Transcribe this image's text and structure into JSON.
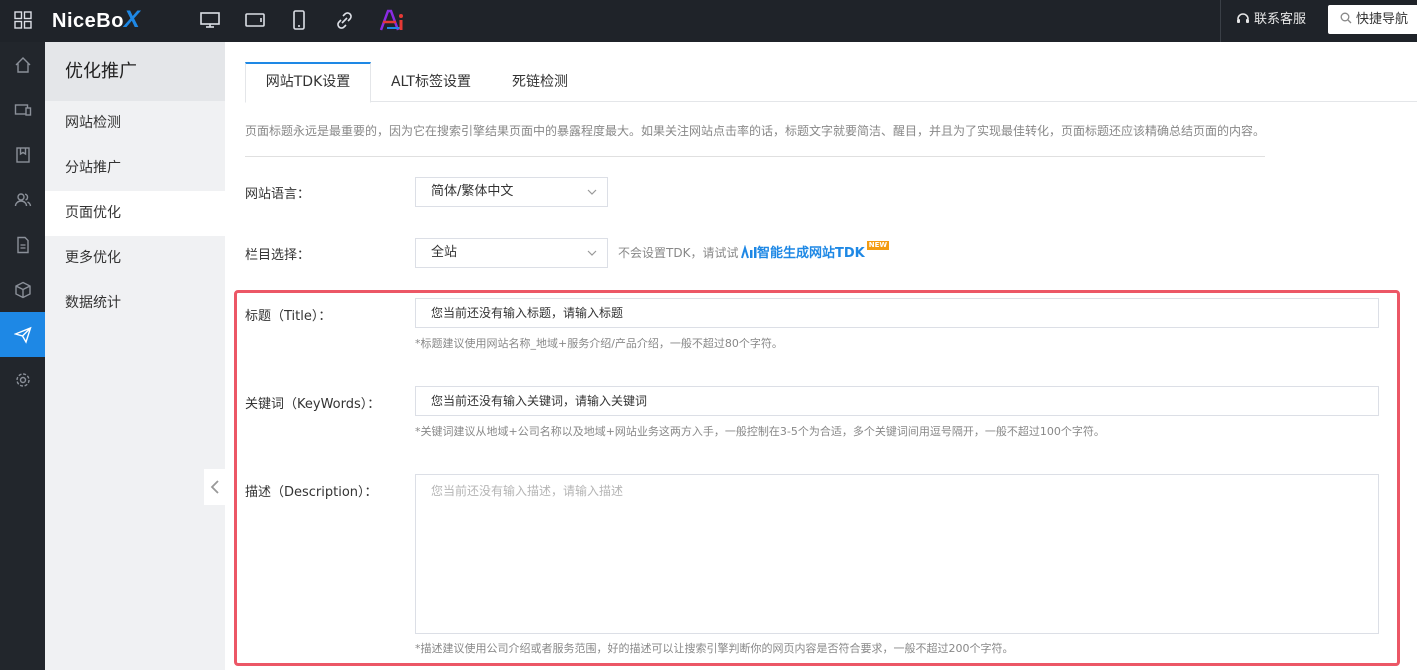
{
  "topbar": {
    "logo_main": "NiceBo",
    "logo_x": "X",
    "icons": [
      "grid-icon",
      "monitor-icon",
      "tablet-icon",
      "phone-icon",
      "link-icon",
      "ai-icon"
    ],
    "ai_badge": "Ai",
    "service_label": "联系客服",
    "quick_nav_label": "快捷导航"
  },
  "rail": {
    "icons": [
      "home-icon",
      "devices-icon",
      "bookmark-icon",
      "users-icon",
      "document-icon",
      "cube-icon",
      "send-icon",
      "settings-icon"
    ],
    "active_index": 6
  },
  "submenu": {
    "title": "优化推广",
    "items": [
      "网站检测",
      "分站推广",
      "页面优化",
      "更多优化",
      "数据统计"
    ],
    "active_index": 2
  },
  "tabs": [
    "网站TDK设置",
    "ALT标签设置",
    "死链检测"
  ],
  "description": "页面标题永远是最重要的，因为它在搜索引擎结果页面中的暴露程度最大。如果关注网站点击率的话，标题文字就要简洁、醒目，并且为了实现最佳转化，页面标题还应该精确总结页面的内容。",
  "language": {
    "label": "网站语言：",
    "value": "简体/繁体中文"
  },
  "column": {
    "label": "栏目选择：",
    "value": "全站",
    "hint": "不会设置TDK，请试试",
    "ai_link": "智能生成网站TDK",
    "new_badge": "NEW"
  },
  "title_field": {
    "label": "标题（Title）：",
    "placeholder": "您当前还没有输入标题，请输入标题",
    "hint": "*标题建议使用网站名称_地域+服务介绍/产品介绍，一般不超过80个字符。"
  },
  "keywords_field": {
    "label": "关键词（KeyWords）：",
    "placeholder": "您当前还没有输入关键词，请输入关键词",
    "hint": "*关键词建议从地域+公司名称以及地域+网站业务这两方入手，一般控制在3-5个为合适，多个关键词间用逗号隔开，一般不超过100个字符。"
  },
  "description_field": {
    "label": "描述（Description）：",
    "placeholder": "您当前还没有输入描述，请输入描述",
    "hint": "*描述建议使用公司介绍或者服务范围，好的描述可以让搜索引擎判断你的网页内容是否符合要求，一般不超过200个字符。"
  },
  "colors": {
    "accent": "#1e88e5",
    "topbar_bg": "#1f2329",
    "highlight_border": "#ec5766"
  }
}
